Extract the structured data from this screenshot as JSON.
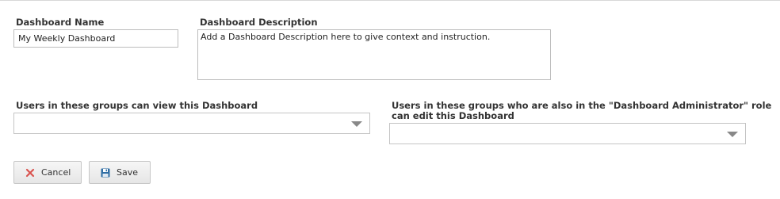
{
  "form": {
    "name_label": "Dashboard Name",
    "name_value": "My Weekly Dashboard",
    "description_label": "Dashboard Description",
    "description_value": "Add a Dashboard Description here to give context and instruction.",
    "view_groups_label": "Users in these groups can view this Dashboard",
    "view_groups_value": "",
    "edit_groups_label_line1": "Users in these groups who are also in the \"Dashboard Administrator\" role",
    "edit_groups_label_line2": "can edit this Dashboard",
    "edit_groups_value": ""
  },
  "actions": {
    "cancel_label": "Cancel",
    "cancel_icon": "close-x-icon",
    "save_label": "Save",
    "save_icon": "floppy-disk-icon"
  },
  "colors": {
    "cancel_icon": "#d9534f",
    "save_icon": "#2e6da4"
  }
}
